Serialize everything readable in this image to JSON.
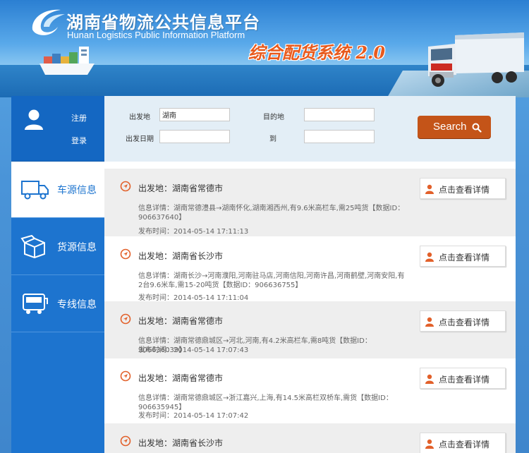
{
  "header": {
    "title_cn": "湖南省物流公共信息平台",
    "title_en": "Hunan Logistics Public Information Platform",
    "system_title": "综合配货系统 2.0"
  },
  "sidebar": {
    "register": "注册",
    "login": "登录",
    "items": [
      {
        "label": "车源信息",
        "icon": "truck-icon",
        "active": true
      },
      {
        "label": "货源信息",
        "icon": "box-icon",
        "active": false
      },
      {
        "label": "专线信息",
        "icon": "bus-icon",
        "active": false
      }
    ]
  },
  "search": {
    "origin_label": "出发地",
    "origin_value": "湖南",
    "dest_label": "目的地",
    "dest_value": "",
    "date_label": "出发日期",
    "date_value": "",
    "to_label": "到",
    "to_value": "",
    "button_label": "Search"
  },
  "listing": {
    "detail_button_label": "点击查看详情",
    "items": [
      {
        "origin": "出发地：湖南省常德市",
        "detail": "信息详情：湖南常德澧县→湖南怀化,湖南湘西州,有9.6米高栏车,需25吨货【数据ID：906637640】",
        "time": "发布时间：2014-05-14 17:11:13"
      },
      {
        "origin": "出发地：湖南省长沙市",
        "detail": "信息详情：湖南长沙→河南濮阳,河南驻马店,河南信阳,河南许昌,河南鹤壁,河南安阳,有2台9.6米车,需15-20吨货【数据ID：906636755】",
        "time": "发布时间：2014-05-14 17:11:04"
      },
      {
        "origin": "出发地：湖南省常德市",
        "detail": "信息详情：湖南常德鼎城区→河北,河南,有4.2米高栏车,需8吨货【数据ID：906636039】",
        "time": "发布时间：2014-05-14 17:07:43"
      },
      {
        "origin": "出发地：湖南省常德市",
        "detail": "信息详情：湖南常德鼎城区→浙江嘉兴,上海,有14.5米高栏双桥车,需货【数据ID：906635945】",
        "time": "发布时间：2014-05-14 17:07:42"
      },
      {
        "origin": "出发地：湖南省长沙市",
        "detail": "",
        "time": ""
      }
    ]
  }
}
